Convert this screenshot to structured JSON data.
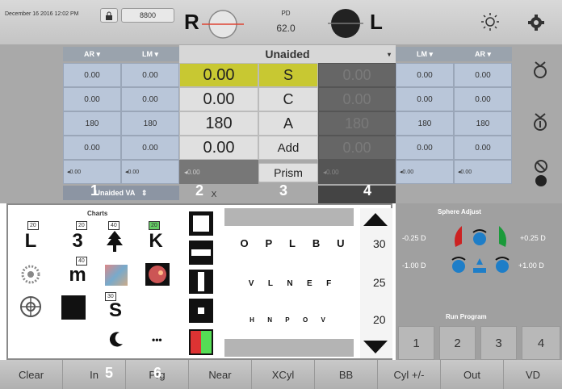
{
  "topbar": {
    "datetime": "December 16 2016 12:02 PM",
    "mode": "8800",
    "r_label": "R",
    "l_label": "L",
    "pd_label": "PD",
    "pd_value": "62.0"
  },
  "grid": {
    "left_headers": [
      "AR",
      "LM"
    ],
    "right_headers": [
      "LM",
      "AR"
    ],
    "center_header": "Unaided",
    "row_labels": [
      "S",
      "C",
      "A",
      "Add",
      "Prism"
    ],
    "left_ar": [
      "0.00",
      "0.00",
      "180",
      "0.00"
    ],
    "left_lm": [
      "0.00",
      "0.00",
      "180",
      "0.00"
    ],
    "right_values": [
      "0.00",
      "0.00",
      "180",
      "0.00"
    ],
    "right_dark": [
      "0.00",
      "0.00",
      "180",
      "0.00"
    ],
    "right_lm": [
      "0.00",
      "0.00",
      "180",
      "0.00"
    ],
    "right_ar": [
      "0.00",
      "0.00",
      "180",
      "0.00"
    ],
    "prism_small": "0.00",
    "va_label": "Unaided VA",
    "x_label": "X"
  },
  "popup": {
    "charts_title": "Charts",
    "chart_L": "L",
    "chart_3": "3",
    "chart_K": "K",
    "chart_m": "m",
    "chart_S": "S",
    "tag_20a": "20",
    "tag_20b": "20",
    "tag_40a": "40",
    "tag_20c": "20",
    "tag_40b": "40",
    "tag_30": "30",
    "more": "•••",
    "rows": [
      [
        "O",
        "P",
        "L",
        "B",
        "U"
      ],
      [
        "V",
        "L",
        "N",
        "E",
        "F"
      ],
      [
        "H",
        "N",
        "P",
        "O",
        "V"
      ]
    ],
    "sizes": [
      "30",
      "25",
      "20"
    ]
  },
  "callouts": [
    "1",
    "2",
    "3",
    "4",
    "5",
    "6"
  ],
  "sphere": {
    "title": "Sphere Adjust",
    "minus025": "-0.25 D",
    "plus025": "+0.25 D",
    "minus100": "-1.00 D",
    "plus100": "+1.00 D"
  },
  "run": {
    "title": "Run Program",
    "buttons": [
      "1",
      "2",
      "3",
      "4"
    ]
  },
  "bottom": [
    "Clear",
    "In",
    "Prg",
    "Near",
    "XCyl",
    "BB",
    "Cyl +/-",
    "Out",
    "VD"
  ]
}
